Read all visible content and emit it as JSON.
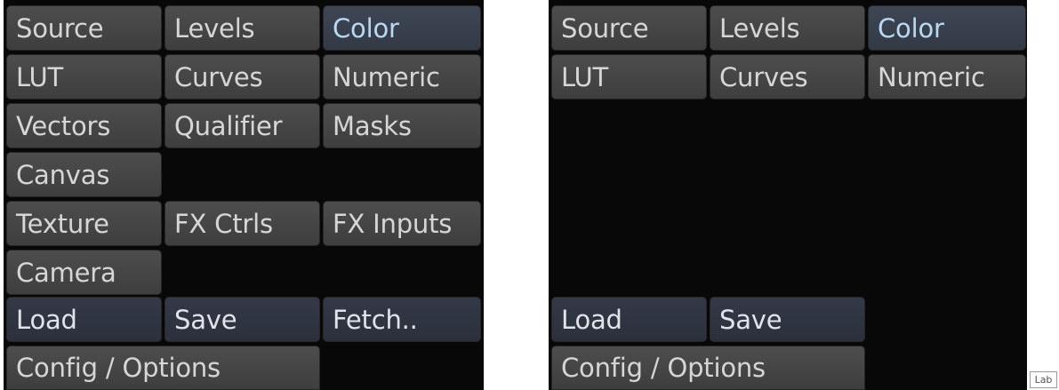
{
  "panel_left": {
    "source": "Source",
    "levels": "Levels",
    "color": "Color",
    "lut": "LUT",
    "curves": "Curves",
    "numeric": "Numeric",
    "vectors": "Vectors",
    "qualifier": "Qualifier",
    "masks": "Masks",
    "canvas": "Canvas",
    "texture": "Texture",
    "fx_ctrls": "FX Ctrls",
    "fx_inputs": "FX Inputs",
    "camera": "Camera",
    "load": "Load",
    "save": "Save",
    "fetch": "Fetch..",
    "config": "Config / Options"
  },
  "panel_right": {
    "source": "Source",
    "levels": "Levels",
    "color": "Color",
    "lut": "LUT",
    "curves": "Curves",
    "numeric": "Numeric",
    "load": "Load",
    "save": "Save",
    "config": "Config / Options"
  },
  "selected_tab": "Color",
  "corner_tag": "Lab",
  "colors": {
    "panel_bg": "#080808",
    "button_bg": "#464646",
    "button_text": "#d6d6d6",
    "selected_text": "#b9d8f2",
    "io_button_bg": "#303541"
  }
}
